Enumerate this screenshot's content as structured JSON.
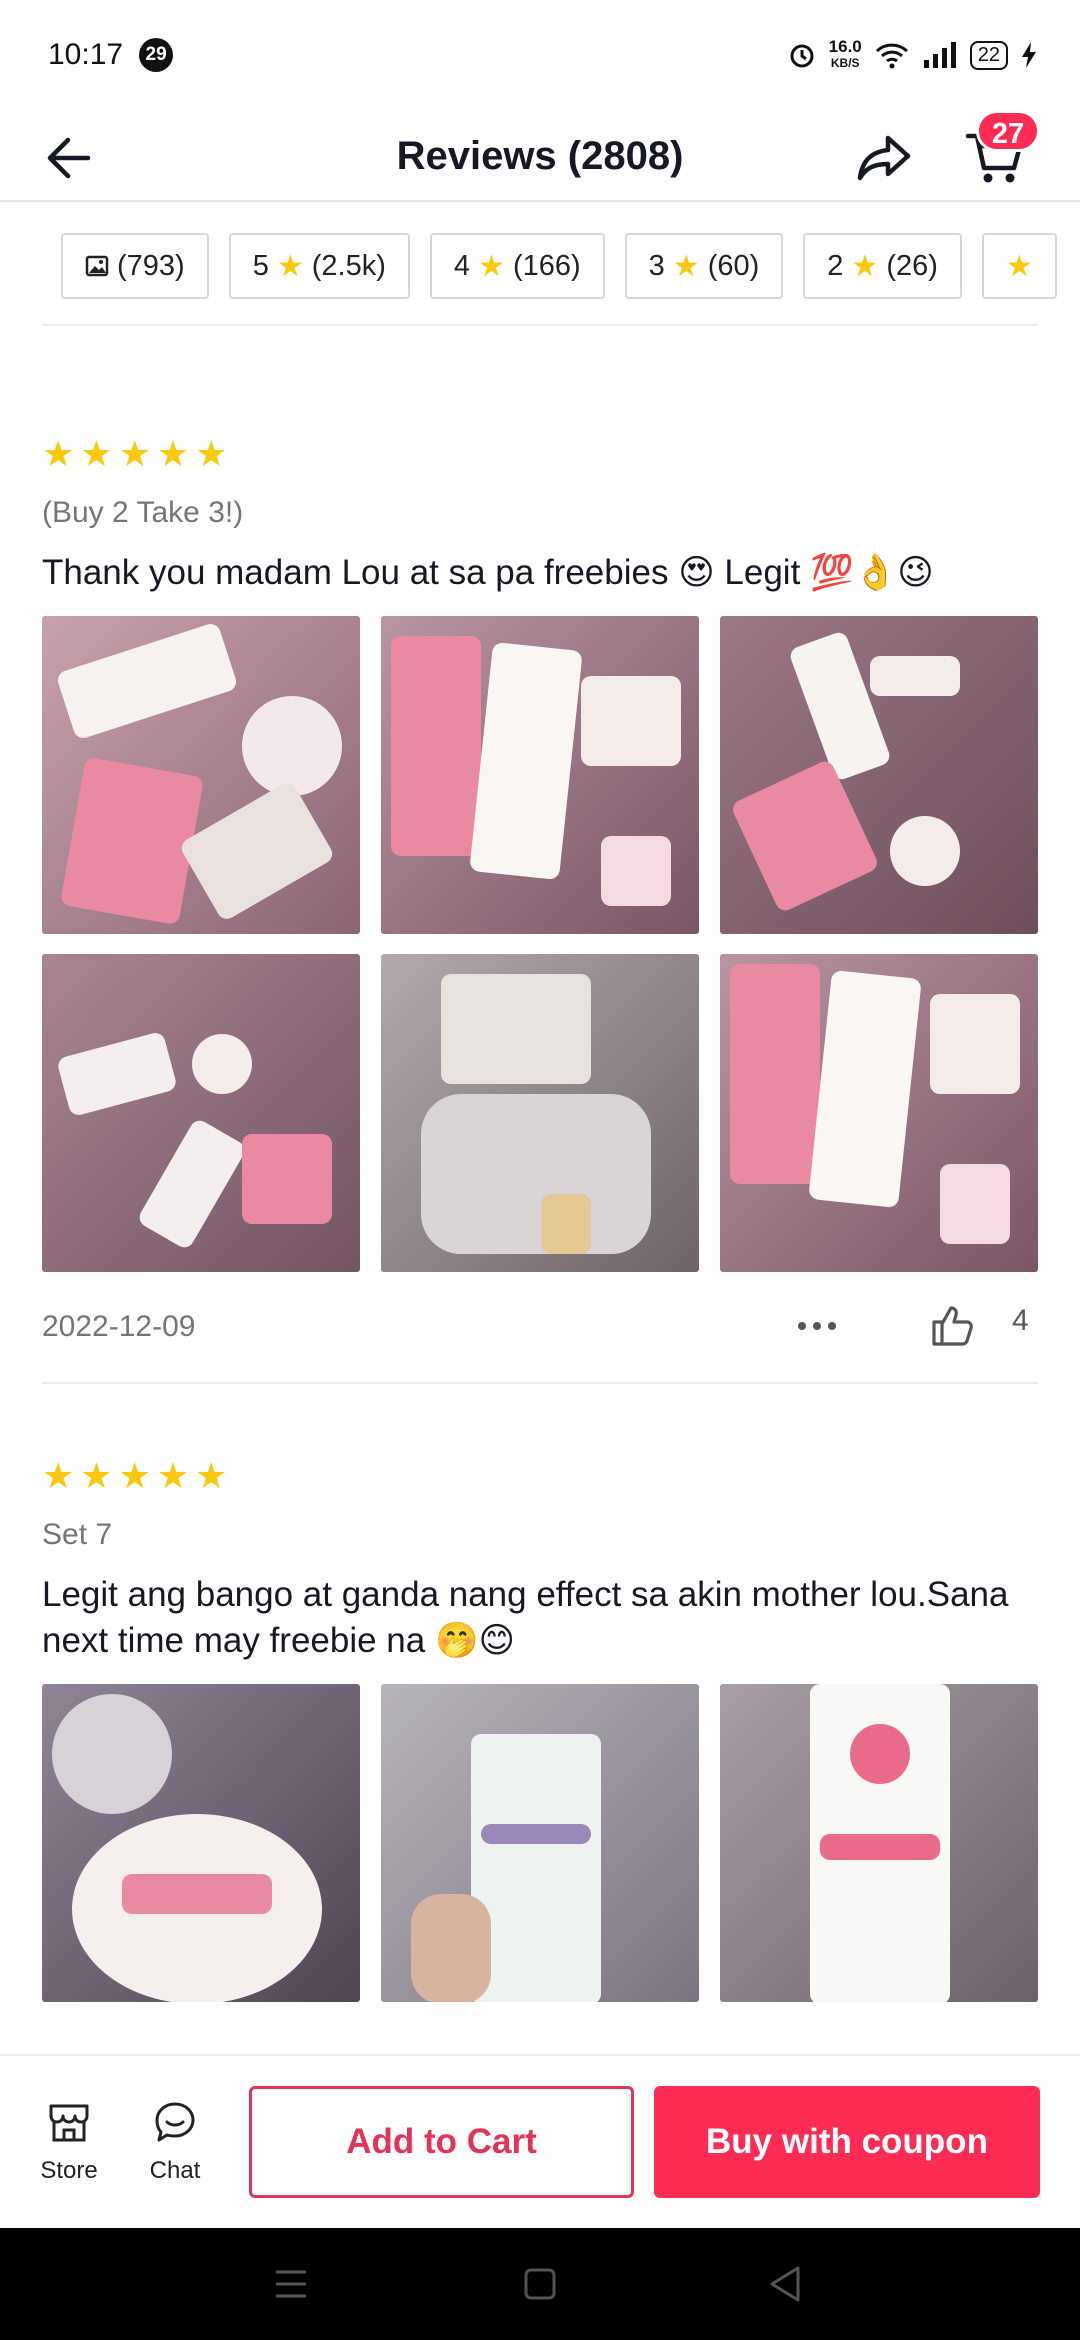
{
  "status_bar": {
    "time": "10:17",
    "notification_count": "29",
    "net_speed_value": "16.0",
    "net_speed_unit": "KB/S",
    "battery": "22"
  },
  "header": {
    "title": "Reviews (2808)",
    "cart_count": "27"
  },
  "filters": [
    {
      "label": "(793)",
      "icon": "image-icon"
    },
    {
      "prefix": "5",
      "label": "(2.5k)",
      "icon": "star-icon"
    },
    {
      "prefix": "4",
      "label": "(166)",
      "icon": "star-icon"
    },
    {
      "prefix": "3",
      "label": "(60)",
      "icon": "star-icon"
    },
    {
      "prefix": "2",
      "label": "(26)",
      "icon": "star-icon"
    }
  ],
  "reviews": [
    {
      "rating": 5,
      "variant": "(Buy 2 Take 3!)",
      "text": "Thank you madam Lou at sa pa freebies 😍 Legit 💯👌😉",
      "photo_count": 6,
      "date": "2022-12-09",
      "likes": "4"
    },
    {
      "rating": 5,
      "variant": "Set 7",
      "text": "Legit ang bango at ganda nang effect sa akin mother lou.Sana next time may freebie na 🤭😊",
      "photo_count": 3
    }
  ],
  "bottom_bar": {
    "store_label": "Store",
    "chat_label": "Chat",
    "add_to_cart_label": "Add to Cart",
    "buy_label": "Buy with coupon"
  },
  "colors": {
    "accent": "#fe2c55",
    "star": "#fac90e",
    "outline_button": "#e23458"
  }
}
